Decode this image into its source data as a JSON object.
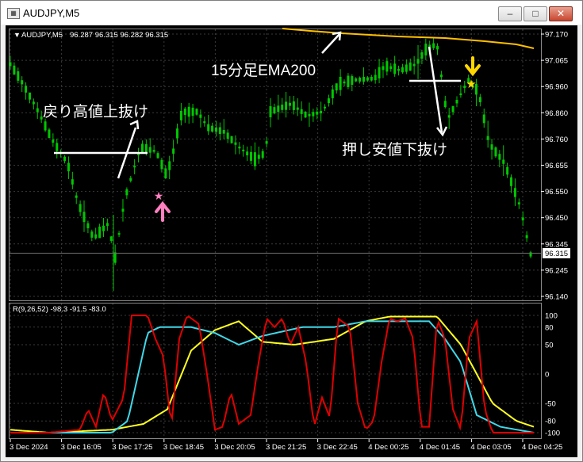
{
  "window": {
    "title": "AUDJPY,M5",
    "minimize_glyph": "–",
    "maximize_glyph": "□",
    "close_glyph": "✕"
  },
  "header": {
    "symbol": "AUDJPY,M5",
    "ohlc": "96.287 96.315 96.282 96.315"
  },
  "price_axis": {
    "ticks": [
      "97.170",
      "97.065",
      "96.960",
      "96.860",
      "96.760",
      "96.655",
      "96.550",
      "96.450",
      "96.345",
      "96.245",
      "96.140"
    ],
    "current_price": "96.315"
  },
  "time_axis": {
    "ticks": [
      "3 Dec 2024",
      "3 Dec 16:05",
      "3 Dec 17:25",
      "3 Dec 18:45",
      "3 Dec 20:05",
      "3 Dec 21:25",
      "3 Dec 22:45",
      "4 Dec 00:25",
      "4 Dec 01:45",
      "4 Dec 03:05",
      "4 Dec 04:25"
    ]
  },
  "annotations": {
    "ema_label": "15分足EMA200",
    "pullback_label": "戻り高値上抜け",
    "dip_label": "押し安値下抜け"
  },
  "indicator": {
    "label": "R(9,26,52) -98.3 -91.5 -83.0",
    "levels": [
      "100",
      "80",
      "50",
      "0",
      "-50",
      "-80",
      "-100"
    ]
  },
  "colors": {
    "background": "#000000",
    "candle": "#00c800",
    "grid": "#3a3a3a",
    "ema": "#ffc000",
    "osc_fast": "#e00000",
    "osc_mid": "#40d8e8",
    "osc_slow": "#ffff20",
    "buy_marker": "#ff80c0",
    "sell_marker": "#ffd700"
  }
}
